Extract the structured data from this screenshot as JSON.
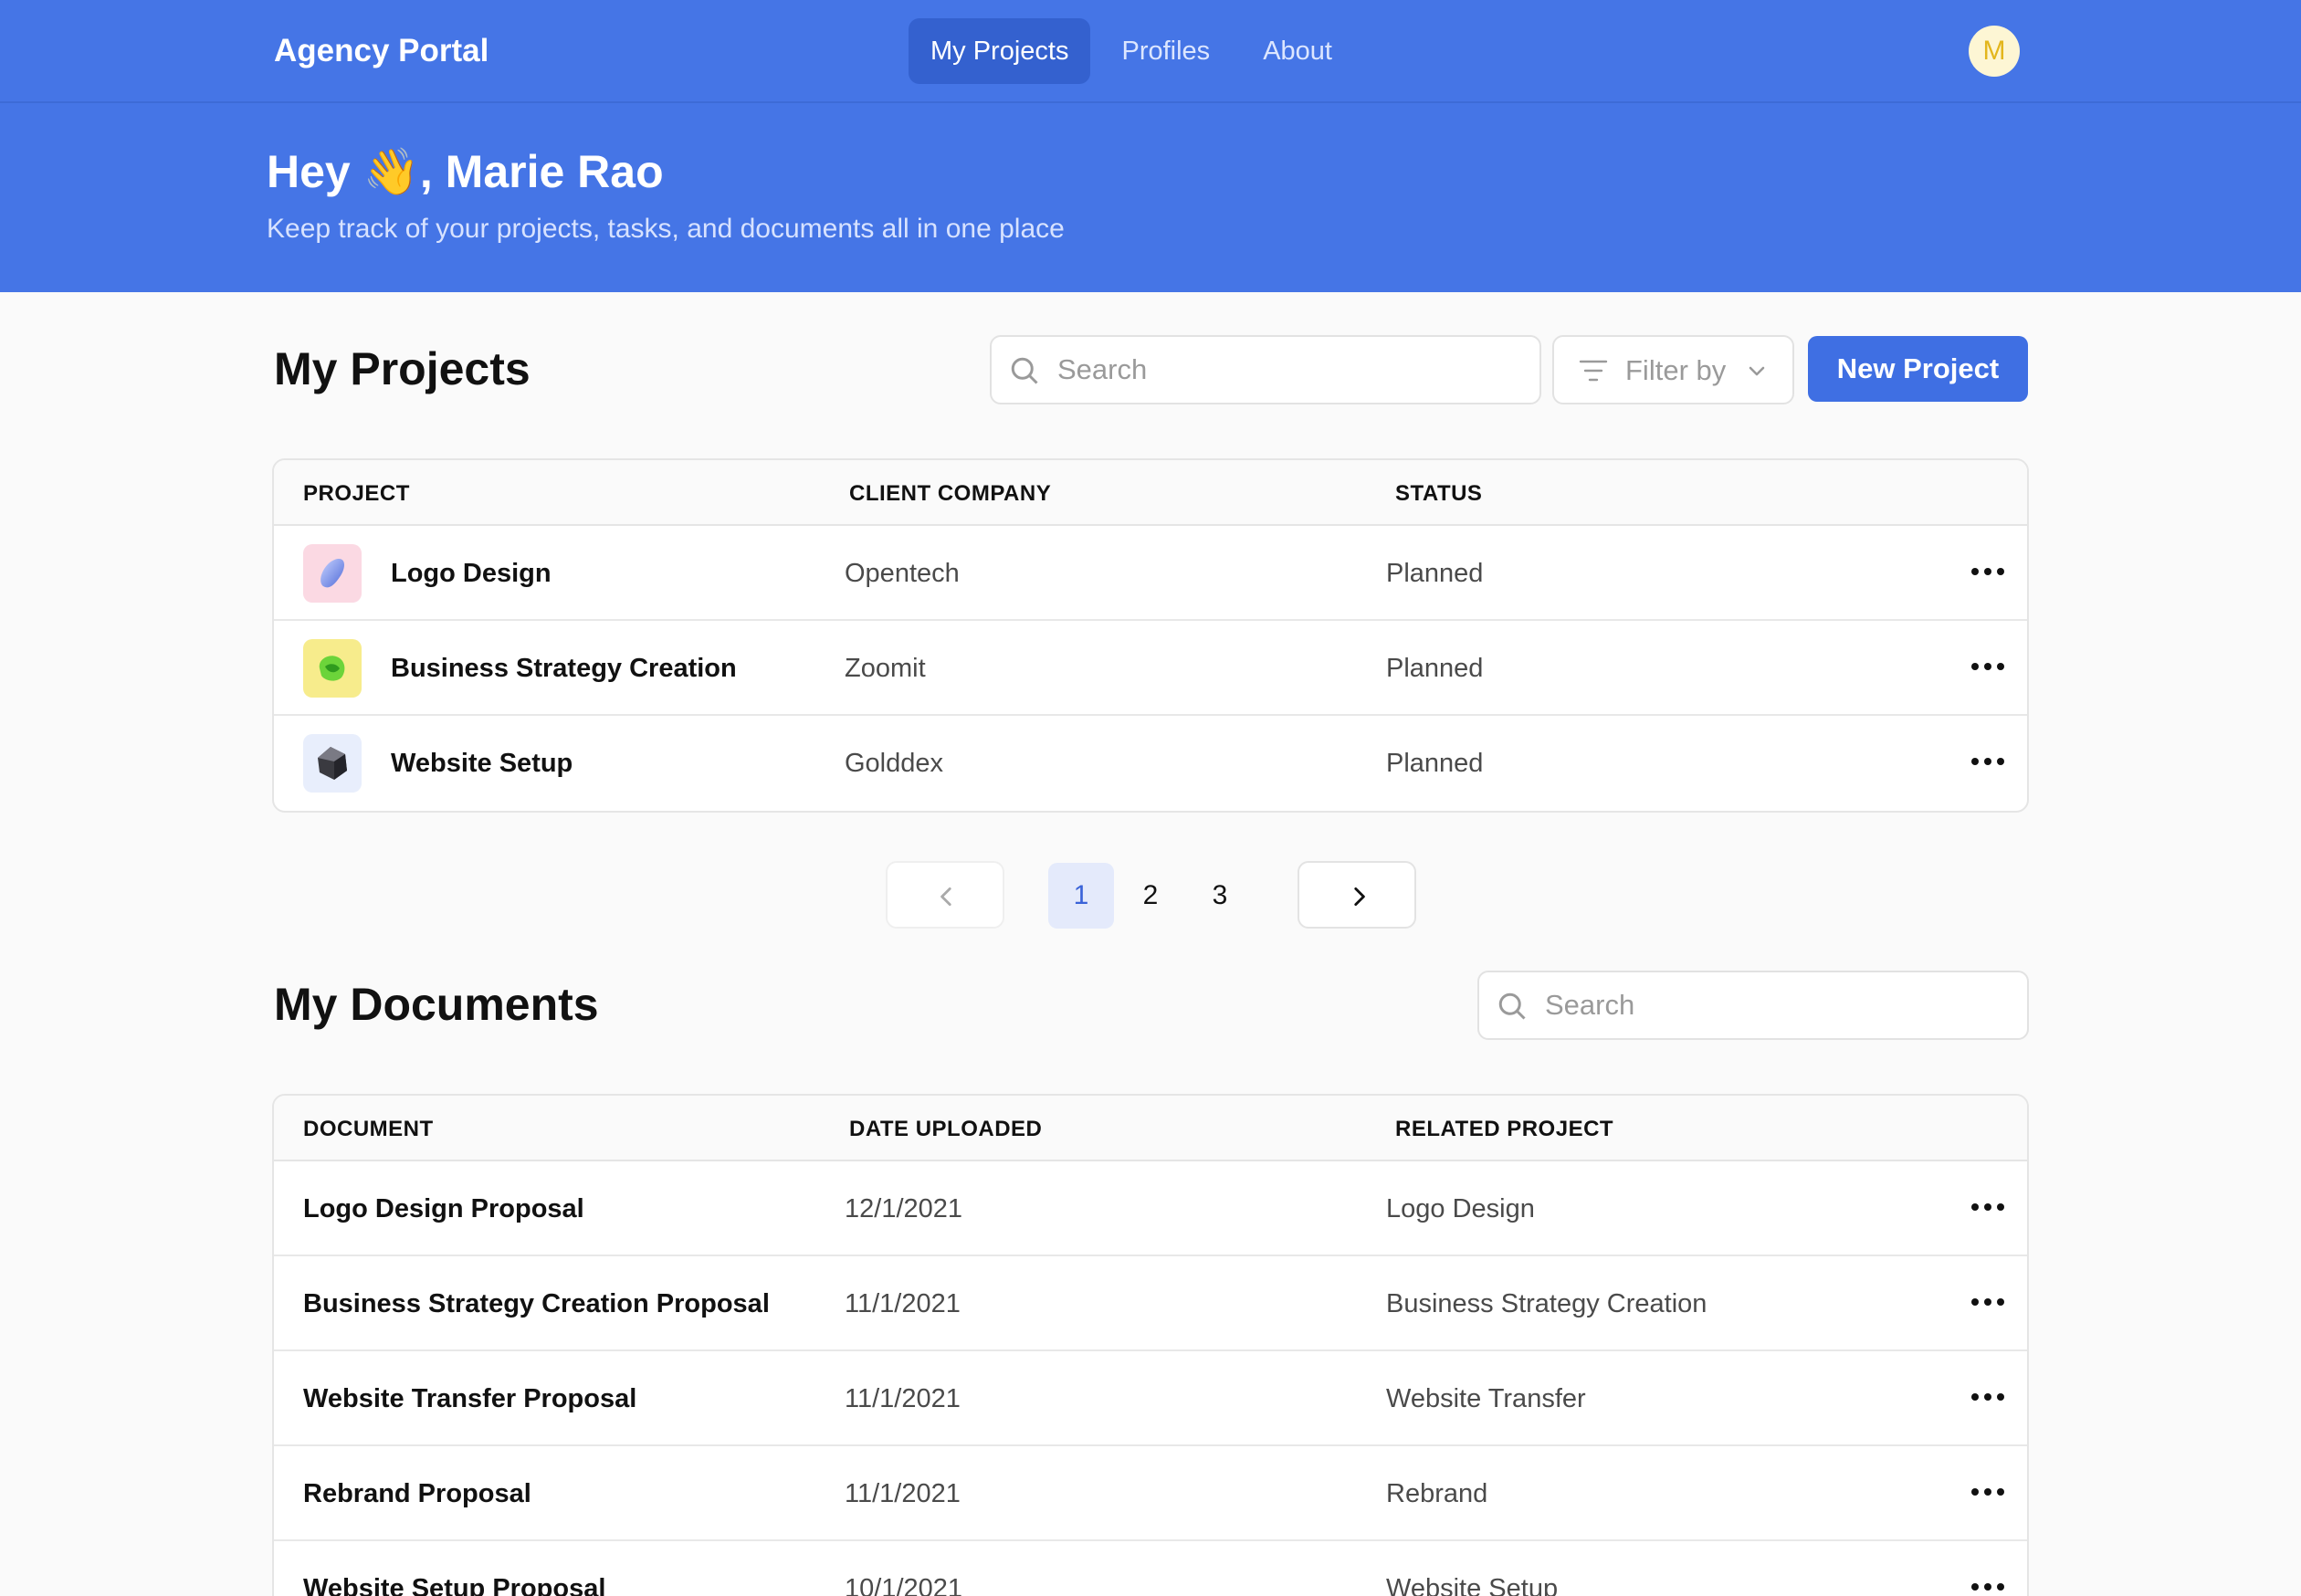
{
  "app": {
    "brand": "Agency Portal",
    "nav": [
      "My Projects",
      "Profiles",
      "About"
    ],
    "active_nav": "My Projects",
    "avatar_initial": "M"
  },
  "hero": {
    "greeting_prefix": "Hey ",
    "wave": "👋",
    "greeting_suffix": ", Marie Rao",
    "subtitle": "Keep track of your projects, tasks, and documents all in one place"
  },
  "projects": {
    "title": "My Projects",
    "search_placeholder": "Search",
    "filter_label": "Filter by",
    "new_button": "New Project",
    "columns": [
      "PROJECT",
      "CLIENT COMPANY",
      "STATUS"
    ],
    "rows": [
      {
        "name": "Logo Design",
        "client": "Opentech",
        "status": "Planned",
        "icon": "logo-design-icon"
      },
      {
        "name": "Business Strategy Creation",
        "client": "Zoomit",
        "status": "Planned",
        "icon": "business-strategy-icon"
      },
      {
        "name": "Website Setup",
        "client": "Golddex",
        "status": "Planned",
        "icon": "website-setup-icon"
      }
    ],
    "pagination": {
      "pages": [
        "1",
        "2",
        "3"
      ],
      "current": "1"
    }
  },
  "documents": {
    "title": "My Documents",
    "search_placeholder": "Search",
    "columns": [
      "DOCUMENT",
      "DATE UPLOADED",
      "RELATED PROJECT"
    ],
    "rows": [
      {
        "name": "Logo Design Proposal",
        "date": "12/1/2021",
        "project": "Logo Design"
      },
      {
        "name": "Business Strategy Creation Proposal",
        "date": "11/1/2021",
        "project": "Business Strategy Creation"
      },
      {
        "name": "Website Transfer Proposal",
        "date": "11/1/2021",
        "project": "Website Transfer"
      },
      {
        "name": "Rebrand Proposal",
        "date": "11/1/2021",
        "project": "Rebrand"
      },
      {
        "name": "Website Setup Proposal",
        "date": "10/1/2021",
        "project": "Website Setup"
      }
    ]
  },
  "colors": {
    "header": "#4575e6",
    "primary": "#3f6fe3",
    "active_page_bg": "#e4eafb"
  }
}
